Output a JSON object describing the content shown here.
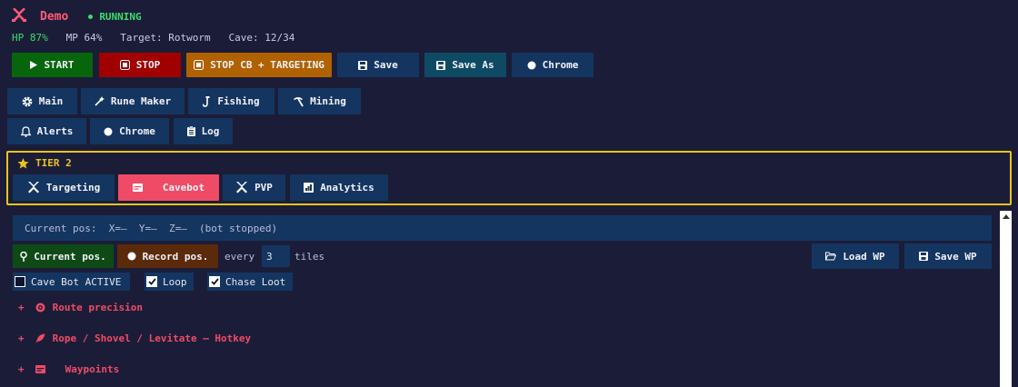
{
  "header": {
    "app_name": "Demo",
    "status": "RUNNING"
  },
  "stats": {
    "hp": "HP 87%",
    "mp": "MP 64%",
    "target": "Target: Rotworm",
    "cave": "Cave: 12/34"
  },
  "toolbar": {
    "start": "START",
    "stop": "STOP",
    "stop_cb": "STOP CB + TARGETING",
    "save": "Save",
    "save_as": "Save As",
    "chrome": "Chrome"
  },
  "nav": {
    "main": "Main",
    "rune_maker": "Rune Maker",
    "fishing": "Fishing",
    "mining": "Mining",
    "alerts": "Alerts",
    "chrome": "Chrome",
    "log": "Log"
  },
  "tier": {
    "label": "TIER 2",
    "tabs": {
      "targeting": "Targeting",
      "cavebot": "Cavebot",
      "pvp": "PVP",
      "analytics": "Analytics"
    },
    "active_tab": "Cavebot"
  },
  "cavebot": {
    "current_pos": "Current pos:  X=–  Y=–  Z=–  (bot stopped)",
    "current_pos_button": "Current pos.",
    "record_pos_button": "Record pos.",
    "every_label": "every",
    "tiles_value": "3",
    "tiles_label": "tiles",
    "load_wp": "Load WP",
    "save_wp": "Save WP",
    "checks": {
      "cave_bot_active": {
        "label": "Cave Bot ACTIVE",
        "checked": false
      },
      "loop": {
        "label": "Loop",
        "checked": true
      },
      "chase_loot": {
        "label": "Chase Loot",
        "checked": true
      }
    },
    "sections": {
      "route_precision": "Route precision",
      "rope_shovel": "Rope / Shovel / Levitate — Hotkey",
      "waypoints": "Waypoints"
    },
    "section_toggle": "+"
  },
  "colors": {
    "background": "#1b1d38",
    "accent_pink": "#f04b66",
    "running_green": "#3ddc6a",
    "tier_gold": "#e8c420",
    "button_blue": "#143560"
  }
}
